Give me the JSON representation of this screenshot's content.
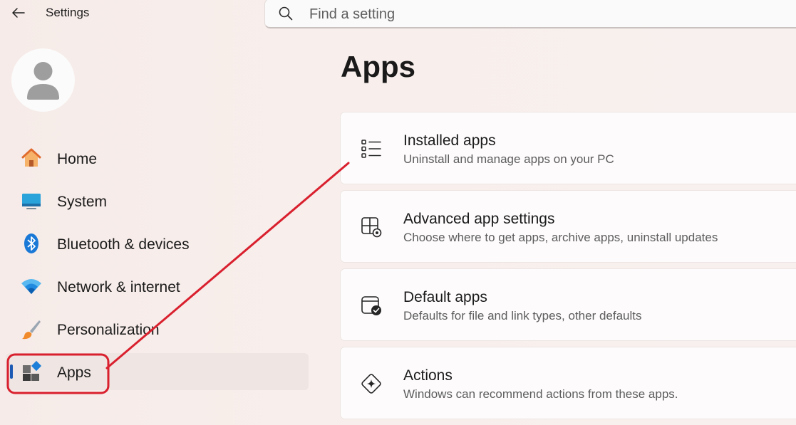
{
  "window": {
    "title": "Settings"
  },
  "search": {
    "placeholder": "Find a setting"
  },
  "sidebar": {
    "items": [
      {
        "label": "Home",
        "icon": "home-icon"
      },
      {
        "label": "System",
        "icon": "system-icon"
      },
      {
        "label": "Bluetooth & devices",
        "icon": "bluetooth-icon"
      },
      {
        "label": "Network & internet",
        "icon": "wifi-icon"
      },
      {
        "label": "Personalization",
        "icon": "brush-icon"
      },
      {
        "label": "Apps",
        "icon": "apps-icon",
        "selected": true
      }
    ]
  },
  "main": {
    "title": "Apps",
    "cards": [
      {
        "title": "Installed apps",
        "description": "Uninstall and manage apps on your PC",
        "icon": "list-icon"
      },
      {
        "title": "Advanced app settings",
        "description": "Choose where to get apps, archive apps, uninstall updates",
        "icon": "app-settings-icon"
      },
      {
        "title": "Default apps",
        "description": "Defaults for file and link types, other defaults",
        "icon": "default-apps-icon"
      },
      {
        "title": "Actions",
        "description": "Windows can recommend actions from these apps.",
        "icon": "actions-icon"
      }
    ]
  },
  "colors": {
    "accent": "#1c5ab4",
    "annotation": "#d9202e"
  }
}
